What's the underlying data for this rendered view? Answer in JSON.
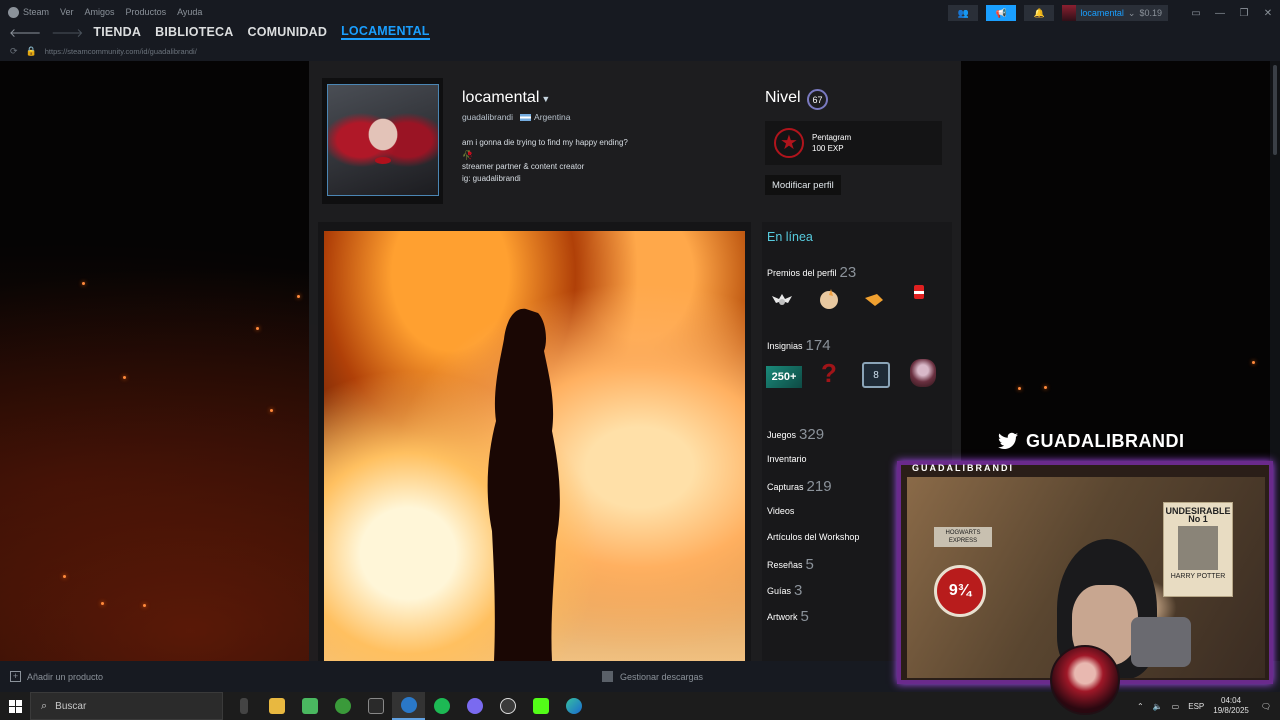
{
  "menubar": {
    "items": [
      "Steam",
      "Ver",
      "Amigos",
      "Productos",
      "Ayuda"
    ]
  },
  "account": {
    "name": "locamental",
    "balance": "$0.19"
  },
  "nav": {
    "items": [
      "TIENDA",
      "BIBLIOTECA",
      "COMUNIDAD",
      "LOCAMENTAL"
    ],
    "active": "LOCAMENTAL"
  },
  "url": "https://steamcommunity.com/id/guadalibrandi/",
  "profile": {
    "name": "locamental",
    "real_name": "guadalibrandi",
    "country": "Argentina",
    "bio": [
      "am i gonna die trying to find my happy ending?",
      "streamer partner & content creator",
      "ig: guadalibrandi"
    ],
    "level_label": "Nivel",
    "level": "67",
    "badge_name": "Pentagram",
    "badge_xp": "100 EXP",
    "edit_button": "Modificar perfil"
  },
  "sidebar": {
    "status": "En línea",
    "awards_label": "Premios del perfil",
    "awards_count": "23",
    "badges_label": "Insignias",
    "badges_count": "174",
    "badge_250": "250+",
    "badge_8": "8",
    "games_label": "Juegos",
    "games_count": "329",
    "inventory": "Inventario",
    "screenshots_label": "Capturas",
    "screenshots_count": "219",
    "videos": "Videos",
    "workshop": "Artículos del Workshop",
    "reviews_label": "Reseñas",
    "reviews_count": "5",
    "guides_label": "Guías",
    "guides_count": "3",
    "artwork_label": "Artwork",
    "artwork_count": "5"
  },
  "overlay": {
    "twitter_handle": "GUADALIBRANDI",
    "cam_label": "GUADALIBRANDI",
    "poster_hogwarts": "HOGWARTS EXPRESS",
    "poster_platform": "9¾",
    "poster_undesirable": "UNDESIRABLE",
    "poster_no1": "No 1",
    "poster_harry": "HARRY POTTER"
  },
  "bottombar": {
    "add_product": "Añadir un producto",
    "downloads": "Gestionar descargas"
  },
  "taskbar": {
    "search": "Buscar",
    "lang": "ESP",
    "time": "04:04",
    "date": "19/8/2025"
  },
  "colors": {
    "accent": "#1a9fff",
    "online": "#57cbde",
    "frame": "#6a2a8c"
  }
}
